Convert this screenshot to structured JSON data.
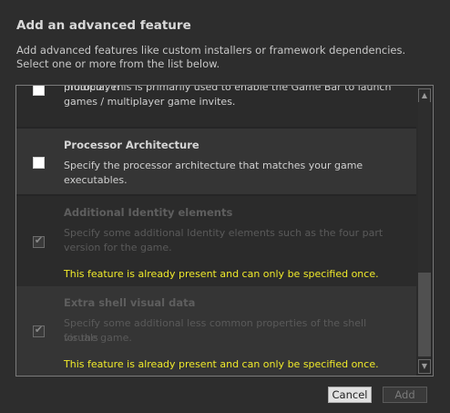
{
  "dialog": {
    "title": "Add an advanced feature",
    "description": "Add advanced features like custom installers or framework dependencies. Select one or more from the list below."
  },
  "features": [
    {
      "name": "",
      "description_line1": "Adds a protocol activation which enables the Game Bar multiplayer",
      "description_line2": "protocol. This is primarily used to enable the Game Bar to launch",
      "description_line3": "games / multiplayer game invites.",
      "checked": false,
      "disabled": false
    },
    {
      "name": "Processor Architecture",
      "description_line1": "Specify the processor architecture that matches your game",
      "description_line2": "executables.",
      "checked": false,
      "disabled": false
    },
    {
      "name": "Additional Identity elements",
      "description_line1": "Specify some additional Identity elements such as the four part",
      "description_line2": "version for the game.",
      "warning": "This feature is already present and can only be specified once.",
      "checked": true,
      "disabled": true
    },
    {
      "name": "Extra shell visual data",
      "description_line1": "Specify some additional less common properties of the shell visuals",
      "description_line2": "for the game.",
      "warning": "This feature is already present and can only be specified once.",
      "checked": true,
      "disabled": true
    }
  ],
  "scrollbar": {
    "up_icon": "chevron-up-icon",
    "down_icon": "chevron-down-icon",
    "up_glyph": "▲",
    "down_glyph": "▼"
  },
  "buttons": {
    "cancel_label": "Cancel",
    "add_label": "Add"
  },
  "icons": {
    "checkmark_glyph": "✔"
  },
  "colors": {
    "warning": "#f0ea2a",
    "background": "#2d2d2d"
  }
}
